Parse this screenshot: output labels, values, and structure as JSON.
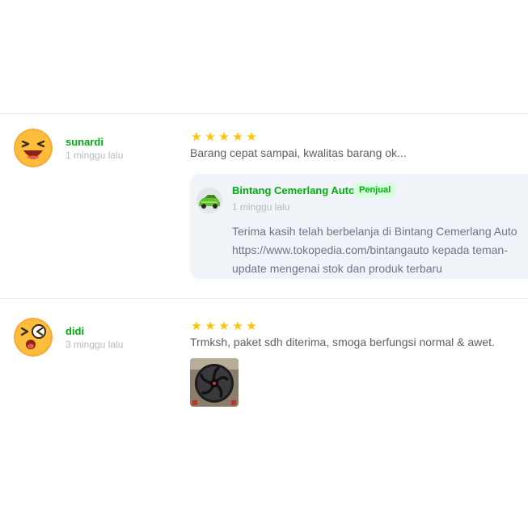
{
  "reviews": [
    {
      "username": "sunardi",
      "time": "1 minggu lalu",
      "rating": 5,
      "text": "Barang cepat sampai, kwalitas barang ok...",
      "avatar_icon": "laughing-emoji-icon",
      "reply": {
        "seller_name": "Bintang Cemerlang Auto",
        "badge": "Penjual",
        "time": "1 minggu lalu",
        "text": "Terima kasih telah berbelanja di Bintang Cemerlang Auto\nhttps://www.tokopedia.com/bintangauto kepada teman-\nupdate mengenai stok dan produk terbaru"
      }
    },
    {
      "username": "didi",
      "time": "3 minggu lalu",
      "rating": 5,
      "text": "Trmksh, paket sdh diterima, smoga berfungsi normal & awet.",
      "avatar_icon": "silly-emoji-icon",
      "photo_icon": "radiator-fan-photo"
    }
  ],
  "colors": {
    "username": "#03ac0e",
    "star": "#ffc400",
    "reply_bg": "#f0f3f7",
    "badge_bg": "#d6ffde"
  }
}
